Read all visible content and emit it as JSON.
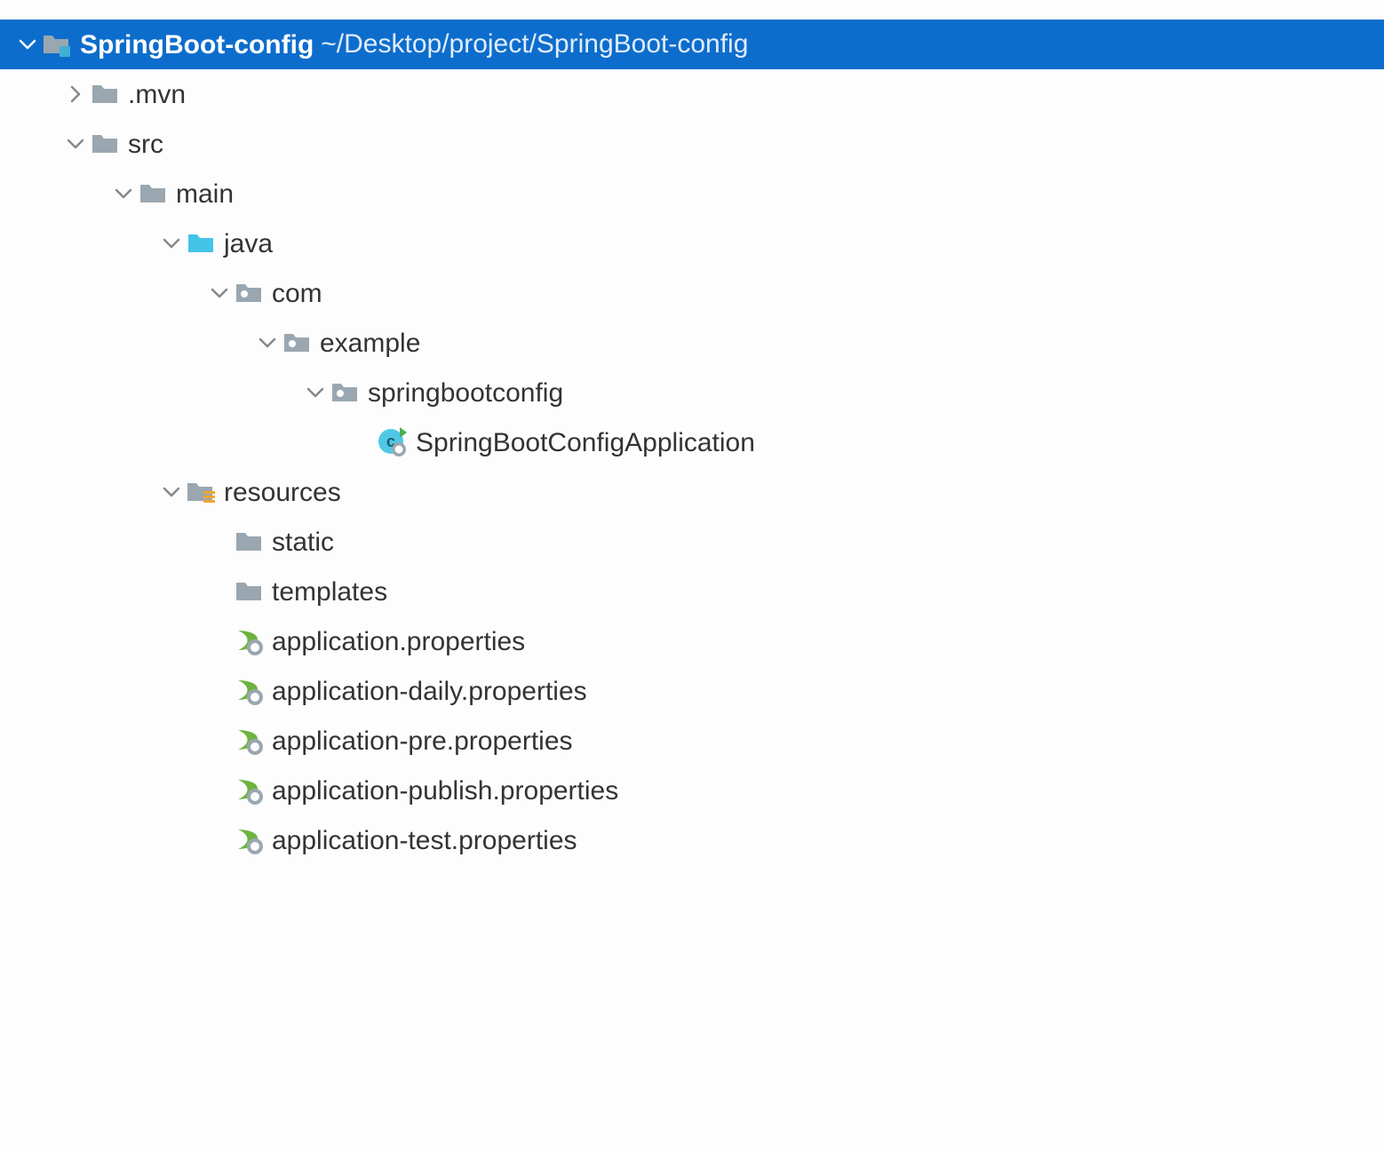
{
  "tree": {
    "root": {
      "name": "SpringBoot-config",
      "path": "~/Desktop/project/SpringBoot-config",
      "children": [
        {
          "name": ".mvn",
          "expanded": false,
          "icon": "folder-grey"
        },
        {
          "name": "src",
          "expanded": true,
          "icon": "folder-grey",
          "children": [
            {
              "name": "main",
              "expanded": true,
              "icon": "folder-grey",
              "children": [
                {
                  "name": "java",
                  "expanded": true,
                  "icon": "folder-source-cyan",
                  "children": [
                    {
                      "name": "com",
                      "expanded": true,
                      "icon": "package",
                      "children": [
                        {
                          "name": "example",
                          "expanded": true,
                          "icon": "package",
                          "children": [
                            {
                              "name": "springbootconfig",
                              "expanded": true,
                              "icon": "package",
                              "children": [
                                {
                                  "name": "SpringBootConfigApplication",
                                  "icon": "spring-runnable-class"
                                }
                              ]
                            }
                          ]
                        }
                      ]
                    }
                  ]
                },
                {
                  "name": "resources",
                  "expanded": true,
                  "icon": "folder-resources",
                  "children": [
                    {
                      "name": "static",
                      "icon": "folder-grey"
                    },
                    {
                      "name": "templates",
                      "icon": "folder-grey"
                    },
                    {
                      "name": "application.properties",
                      "icon": "spring-properties"
                    },
                    {
                      "name": "application-daily.properties",
                      "icon": "spring-properties"
                    },
                    {
                      "name": "application-pre.properties",
                      "icon": "spring-properties"
                    },
                    {
                      "name": "application-publish.properties",
                      "icon": "spring-properties"
                    },
                    {
                      "name": "application-test.properties",
                      "icon": "spring-properties"
                    }
                  ]
                }
              ]
            }
          ]
        }
      ]
    }
  }
}
